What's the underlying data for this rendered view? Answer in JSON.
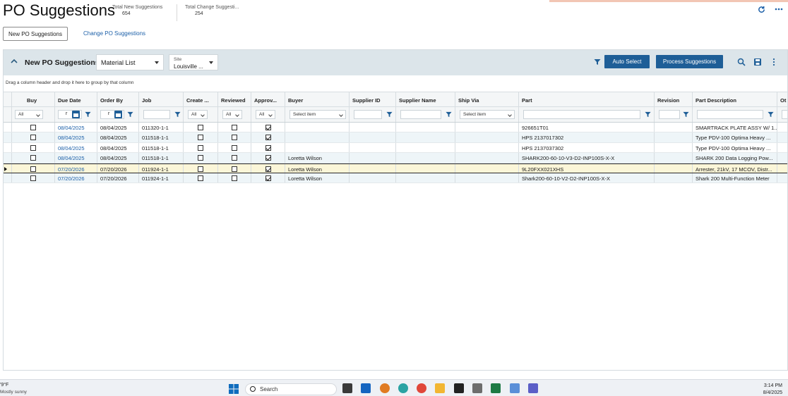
{
  "page": {
    "title": "PO Suggestions",
    "metrics": [
      {
        "label": "Total New Suggestions",
        "value": "654"
      },
      {
        "label": "Total Change Suggesti...",
        "value": "254"
      }
    ],
    "tabs": {
      "new": "New PO Suggestions",
      "change": "Change PO Suggestions"
    }
  },
  "panel": {
    "title": "New PO Suggestions",
    "view_select": "Material List",
    "site_label": "Site",
    "site_value": "Louisville ...",
    "auto_select": "Auto Select",
    "process": "Process Suggestions",
    "group_hint": "Drag a column header and drop it here to group by that column"
  },
  "grid": {
    "columns": [
      "Buy",
      "Due Date",
      "Order By",
      "Job",
      "Create ...",
      "Reviewed",
      "Approv...",
      "Buyer",
      "Supplier ID",
      "Supplier Name",
      "Ship Via",
      "Part",
      "Revision",
      "Part Description",
      "Ot"
    ],
    "filters": {
      "all": "All",
      "select_item": "Select item",
      "date_prefix": "r"
    },
    "rows": [
      {
        "buy": false,
        "due": "08/04/2025",
        "order_by": "08/04/2025",
        "job": "011320-1-1",
        "created": false,
        "reviewed": false,
        "approved": true,
        "buyer": "",
        "supplier_id": "",
        "supplier_name": "",
        "ship_via": "",
        "part": "926651T01",
        "revision": "",
        "desc": "SMARTRACK PLATE ASSY W/ 1..."
      },
      {
        "buy": false,
        "due": "08/04/2025",
        "order_by": "08/04/2025",
        "job": "011518-1-1",
        "created": false,
        "reviewed": false,
        "approved": true,
        "buyer": "",
        "supplier_id": "",
        "supplier_name": "",
        "ship_via": "",
        "part": "HPS 2137017302",
        "revision": "",
        "desc": "Type PDV-100 Optima Heavy ..."
      },
      {
        "buy": false,
        "due": "08/04/2025",
        "order_by": "08/04/2025",
        "job": "011518-1-1",
        "created": false,
        "reviewed": false,
        "approved": true,
        "buyer": "",
        "supplier_id": "",
        "supplier_name": "",
        "ship_via": "",
        "part": "HPS 2137037302",
        "revision": "",
        "desc": "Type PDV-100 Optima Heavy ..."
      },
      {
        "buy": false,
        "due": "08/04/2025",
        "order_by": "08/04/2025",
        "job": "011518-1-1",
        "created": false,
        "reviewed": false,
        "approved": true,
        "buyer": "Loretta Wilson",
        "supplier_id": "",
        "supplier_name": "",
        "ship_via": "",
        "part": "SHARK200-60-10-V3-D2-INP100S-X-X",
        "revision": "",
        "desc": "SHARK 200 Data Logging Pow..."
      },
      {
        "buy": false,
        "due": "07/20/2026",
        "order_by": "07/20/2026",
        "job": "011924-1-1",
        "created": false,
        "reviewed": false,
        "approved": true,
        "buyer": "Loretta Wilson",
        "supplier_id": "",
        "supplier_name": "",
        "ship_via": "",
        "part": "9L20FXX021XHS",
        "revision": "",
        "desc": "Arrester, 21kV, 17 MCOV, Distr..."
      },
      {
        "buy": false,
        "due": "07/20/2026",
        "order_by": "07/20/2026",
        "job": "011924-1-1",
        "created": false,
        "reviewed": false,
        "approved": true,
        "buyer": "Loretta Wilson",
        "supplier_id": "",
        "supplier_name": "",
        "ship_via": "",
        "part": "Shark200-60-10-V2-D2-INP100S-X-X",
        "revision": "",
        "desc": "Shark 200 Multi-Function Meter"
      }
    ],
    "selected_row": 4
  },
  "taskbar": {
    "weather_temp": "'9°F",
    "weather_desc": "Mostly sunny",
    "search": "Search",
    "time": "3:14 PM",
    "date": "8/4/2025"
  },
  "colors": {
    "accent": "#1e5e97",
    "link": "#1b5fa8",
    "header_bg": "#dce5ea",
    "selected_row": "#fbf6d8"
  }
}
